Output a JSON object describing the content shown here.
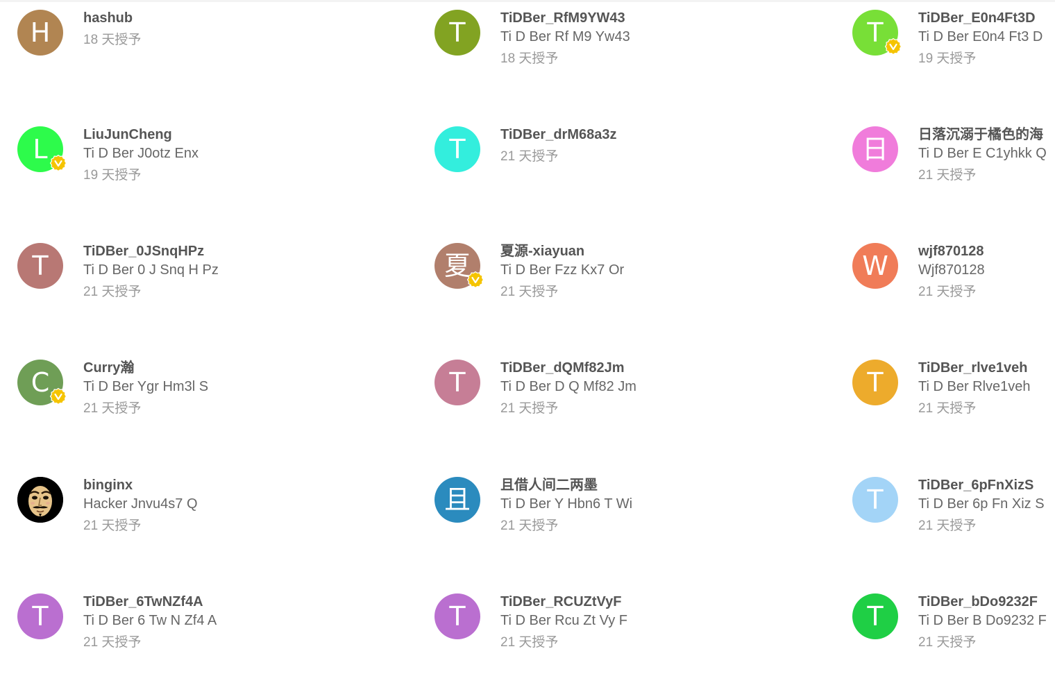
{
  "colors": {
    "badge": "#F5C400",
    "name_text": "#555555",
    "subtitle_text": "#666666",
    "time_text": "#999999"
  },
  "users": [
    {
      "name": "hashub",
      "subtitle": "",
      "time": "18 天授予",
      "avatar_letter": "H",
      "avatar_color": "#B18552",
      "verified": false
    },
    {
      "name": "TiDBer_RfM9YW43",
      "subtitle": "Ti D Ber Rf M9 Yw43",
      "time": "18 天授予",
      "avatar_letter": "T",
      "avatar_color": "#82A322",
      "verified": false
    },
    {
      "name": "TiDBer_E0n4Ft3D",
      "subtitle": "Ti D Ber E0n4 Ft3 D",
      "time": "19 天授予",
      "avatar_letter": "T",
      "avatar_color": "#78DF37",
      "verified": true
    },
    {
      "name": "LiuJunCheng",
      "subtitle": "Ti D Ber J0otz Enx",
      "time": "19 天授予",
      "avatar_letter": "L",
      "avatar_color": "#2DFB4B",
      "verified": true
    },
    {
      "name": "TiDBer_drM68a3z",
      "subtitle": "",
      "time": "21 天授予",
      "avatar_letter": "T",
      "avatar_color": "#33EEDD",
      "verified": false
    },
    {
      "name": "日落沉溺于橘色的海",
      "subtitle": "Ti D Ber E C1yhkk Q",
      "time": "21 天授予",
      "avatar_letter": "日",
      "avatar_color": "#F07CDB",
      "verified": false
    },
    {
      "name": "TiDBer_0JSnqHPz",
      "subtitle": "Ti D Ber 0 J Snq H Pz",
      "time": "21 天授予",
      "avatar_letter": "T",
      "avatar_color": "#B87874",
      "verified": false
    },
    {
      "name": "夏源-xiayuan",
      "subtitle": "Ti D Ber Fzz Kx7 Or",
      "time": "21 天授予",
      "avatar_letter": "夏",
      "avatar_color": "#B17F6C",
      "verified": true
    },
    {
      "name": "wjf870128",
      "subtitle": "Wjf870128",
      "time": "21 天授予",
      "avatar_letter": "W",
      "avatar_color": "#F07C58",
      "verified": false
    },
    {
      "name": "Curry瀚",
      "subtitle": "Ti D Ber Ygr Hm3l S",
      "time": "21 天授予",
      "avatar_letter": "C",
      "avatar_color": "#6F9E56",
      "verified": true
    },
    {
      "name": "TiDBer_dQMf82Jm",
      "subtitle": "Ti D Ber D Q Mf82 Jm",
      "time": "21 天授予",
      "avatar_letter": "T",
      "avatar_color": "#C67E96",
      "verified": false
    },
    {
      "name": "TiDBer_rlve1veh",
      "subtitle": "Ti D Ber Rlve1veh",
      "time": "21 天授予",
      "avatar_letter": "T",
      "avatar_color": "#EDAB2C",
      "verified": false
    },
    {
      "name": "binginx",
      "subtitle": "Hacker Jnvu4s7 Q",
      "time": "21 天授予",
      "avatar_letter": "",
      "avatar_color": "#000000",
      "verified": false,
      "avatar_image": "mask-icon"
    },
    {
      "name": "且借人间二两墨",
      "subtitle": "Ti D Ber Y Hbn6 T Wi",
      "time": "21 天授予",
      "avatar_letter": "且",
      "avatar_color": "#2B8BBE",
      "verified": false
    },
    {
      "name": "TiDBer_6pFnXizS",
      "subtitle": "Ti D Ber 6p Fn Xiz S",
      "time": "21 天授予",
      "avatar_letter": "T",
      "avatar_color": "#A3D4F7",
      "verified": false
    },
    {
      "name": "TiDBer_6TwNZf4A",
      "subtitle": "Ti D Ber 6 Tw N Zf4 A",
      "time": "21 天授予",
      "avatar_letter": "T",
      "avatar_color": "#BA6FD0",
      "verified": false
    },
    {
      "name": "TiDBer_RCUZtVyF",
      "subtitle": "Ti D Ber Rcu Zt Vy F",
      "time": "21 天授予",
      "avatar_letter": "T",
      "avatar_color": "#BA6FD0",
      "verified": false
    },
    {
      "name": "TiDBer_bDo9232F",
      "subtitle": "Ti D Ber B Do9232 F",
      "time": "21 天授予",
      "avatar_letter": "T",
      "avatar_color": "#1FCF45",
      "verified": false
    }
  ]
}
